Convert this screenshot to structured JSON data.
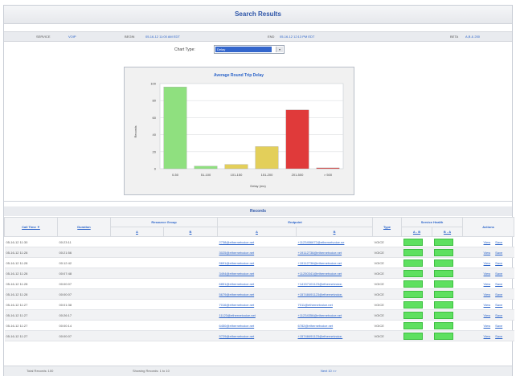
{
  "header": {
    "title": "Search Results"
  },
  "filters": [
    {
      "label": "SERVICE",
      "value": "VOIP"
    },
    {
      "label": "BEGIN",
      "value": "05-16-12 11:00 AM EDT"
    },
    {
      "label": "END",
      "value": "05-16-12 12:13 PM EDT"
    },
    {
      "label": "BETA",
      "value": "A,B & 200"
    }
  ],
  "chart_type": {
    "label": "Chart Type:",
    "selected": "Delay"
  },
  "chart_data": {
    "type": "bar",
    "title": "Average Round Trip Delay",
    "xlabel": "Delay (ms)",
    "ylabel": "Records",
    "ylim": [
      0,
      100
    ],
    "yticks": [
      0,
      20,
      40,
      60,
      80,
      100
    ],
    "categories": [
      "0-50",
      "51-100",
      "101-150",
      "151-200",
      "201-500",
      "> 500"
    ],
    "values": [
      96,
      3,
      5,
      26,
      69,
      1
    ],
    "colors": [
      "#8fe07f",
      "#8fe07f",
      "#e3cf5a",
      "#e3cf5a",
      "#e03a3a",
      "#e03a3a"
    ],
    "grid": true
  },
  "records": {
    "title": "Records",
    "headers": {
      "call_time": "Call Time ▼",
      "duration": "Duration",
      "resource_group": "Resource Group",
      "endpoint": "Endpoint",
      "type": "Type",
      "service_health": "Service Health",
      "actions": "Actions",
      "rg_a": "A",
      "rg_b": "B",
      "ep_a": "A",
      "ep_b": "B",
      "sh_ab": "A - B",
      "sh_ba": "B - A"
    },
    "rows": [
      {
        "time": "05-16-12 11:30",
        "duration": "00:23:11",
        "ep_a": "2738@ethernetvoice.net",
        "ep_b": "+1123456672@ethernetvoice.ne",
        "type": "VOICE",
        "view": "View",
        "save": "Save"
      },
      {
        "time": "05-16-12 11:28",
        "duration": "00:21:56",
        "ep_a": "3025@ethernetvoice.net",
        "ep_b": "+19112736@ethernetvoice.net",
        "type": "VOICE",
        "view": "View",
        "save": "Save"
      },
      {
        "time": "05-16-12 11:28",
        "duration": "00:12:42",
        "ep_a": "5691@ethernetvoice.net",
        "ep_b": "+19112736@ethernetvoice.net",
        "type": "VOICE",
        "view": "View",
        "save": "Save"
      },
      {
        "time": "05-16-12 11:28",
        "duration": "00:07:48",
        "ep_a": "3494@ethernetvoice.net",
        "ep_b": "+11250341@ethernetvoice.net",
        "type": "VOICE",
        "view": "View",
        "save": "Save"
      },
      {
        "time": "05-16-12 11:28",
        "duration": "00:00:07",
        "ep_a": "6851@ethernetvoice.net",
        "ep_b": "+14157101123@ethernetvoice.",
        "type": "VOICE",
        "view": "View",
        "save": "Save"
      },
      {
        "time": "05-16-12 11:28",
        "duration": "00:00:07",
        "ep_a": "5679@ethernetvoice.net",
        "ep_b": "+15748491123@ethernetvoice.",
        "type": "VOICE",
        "view": "View",
        "save": "Save"
      },
      {
        "time": "05-16-12 11:27",
        "duration": "00:01:38",
        "ep_a": "7016@ethernetvoice.net",
        "ep_b": "7011@ethernetvoice.net",
        "type": "VOICE",
        "view": "View",
        "save": "Save"
      },
      {
        "time": "05-16-12 11:27",
        "duration": "00:26:17",
        "ep_a": "11123@ethernetvoice.net",
        "ep_b": "+11234356@ethernetvoice.net",
        "type": "VOICE",
        "view": "View",
        "save": "Save"
      },
      {
        "time": "05-16-12 11:27",
        "duration": "00:00:14",
        "ep_a": "6450@ethernetvoice.net",
        "ep_b": "6782@ethernetvoice.net",
        "type": "VOICE",
        "view": "View",
        "save": "Save"
      },
      {
        "time": "05-16-12 11:27",
        "duration": "00:00:07",
        "ep_a": "5729@ethernetvoice.net",
        "ep_b": "+15748491123@ethernetvoice.",
        "type": "VOICE",
        "view": "View",
        "save": "Save"
      }
    ]
  },
  "footer": {
    "total": "Total Records: 100",
    "showing": "Showing Records: 1 to 10",
    "nav": "Next 10 >>"
  },
  "colors": {
    "accent": "#2a63c9",
    "health_ok": "#5ee060"
  }
}
